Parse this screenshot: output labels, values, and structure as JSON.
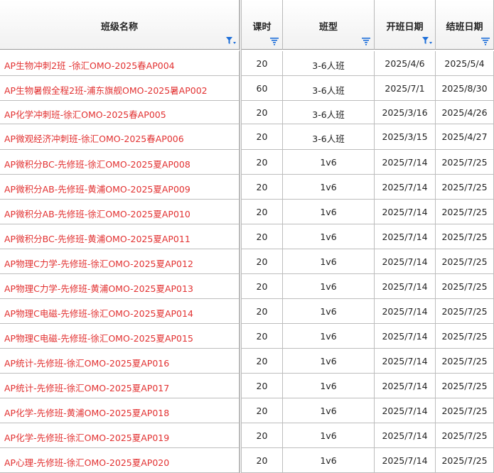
{
  "table": {
    "headers": [
      {
        "key": "name",
        "label": "班级名称",
        "filter": "active"
      },
      {
        "key": "hours",
        "label": "课时",
        "filter": "available"
      },
      {
        "key": "type",
        "label": "班型",
        "filter": "available"
      },
      {
        "key": "start",
        "label": "开班日期",
        "filter": "active"
      },
      {
        "key": "end",
        "label": "结班日期",
        "filter": "available"
      }
    ],
    "rows": [
      {
        "name": "AP生物冲刺2班 -徐汇OMO-2025春AP004",
        "hours": "20",
        "type": "3-6人班",
        "start": "2025/4/6",
        "end": "2025/5/4"
      },
      {
        "name": "AP生物暑假全程2班-浦东旗舰OMO-2025暑AP002",
        "hours": "60",
        "type": "3-6人班",
        "start": "2025/7/1",
        "end": "2025/8/30"
      },
      {
        "name": "AP化学冲刺班-徐汇OMO-2025春AP005",
        "hours": "20",
        "type": "3-6人班",
        "start": "2025/3/16",
        "end": "2025/4/26"
      },
      {
        "name": "AP微观经济冲刺班-徐汇OMO-2025春AP006",
        "hours": "20",
        "type": "3-6人班",
        "start": "2025/3/15",
        "end": "2025/4/27"
      },
      {
        "name": "AP微积分BC-先修班-徐汇OMO-2025夏AP008",
        "hours": "20",
        "type": "1v6",
        "start": "2025/7/14",
        "end": "2025/7/25"
      },
      {
        "name": "AP微积分AB-先修班-黄浦OMO-2025夏AP009",
        "hours": "20",
        "type": "1v6",
        "start": "2025/7/14",
        "end": "2025/7/25"
      },
      {
        "name": "AP微积分AB-先修班-徐汇OMO-2025夏AP010",
        "hours": "20",
        "type": "1v6",
        "start": "2025/7/14",
        "end": "2025/7/25"
      },
      {
        "name": "AP微积分BC-先修班-黄浦OMO-2025夏AP011",
        "hours": "20",
        "type": "1v6",
        "start": "2025/7/14",
        "end": "2025/7/25"
      },
      {
        "name": "AP物理C力学-先修班-徐汇OMO-2025夏AP012",
        "hours": "20",
        "type": "1v6",
        "start": "2025/7/14",
        "end": "2025/7/25"
      },
      {
        "name": "AP物理C力学-先修班-黄浦OMO-2025夏AP013",
        "hours": "20",
        "type": "1v6",
        "start": "2025/7/14",
        "end": "2025/7/25"
      },
      {
        "name": "AP物理C电磁-先修班-徐汇OMO-2025夏AP014",
        "hours": "20",
        "type": "1v6",
        "start": "2025/7/14",
        "end": "2025/7/25"
      },
      {
        "name": "AP物理C电磁-先修班-徐汇OMO-2025夏AP015",
        "hours": "20",
        "type": "1v6",
        "start": "2025/7/14",
        "end": "2025/7/25"
      },
      {
        "name": "AP统计-先修班-徐汇OMO-2025夏AP016",
        "hours": "20",
        "type": "1v6",
        "start": "2025/7/14",
        "end": "2025/7/25"
      },
      {
        "name": "AP统计-先修班-徐汇OMO-2025夏AP017",
        "hours": "20",
        "type": "1v6",
        "start": "2025/7/14",
        "end": "2025/7/25"
      },
      {
        "name": "AP化学-先修班-黄浦OMO-2025夏AP018",
        "hours": "20",
        "type": "1v6",
        "start": "2025/7/14",
        "end": "2025/7/25"
      },
      {
        "name": "AP化学-先修班-徐汇OMO-2025夏AP019",
        "hours": "20",
        "type": "1v6",
        "start": "2025/7/14",
        "end": "2025/7/25"
      },
      {
        "name": "AP心理-先修班-徐汇OMO-2025夏AP020",
        "hours": "20",
        "type": "1v6",
        "start": "2025/7/14",
        "end": "2025/7/25"
      }
    ]
  },
  "colors": {
    "name_text": "#e23131",
    "filter_icon": "#1e6fd9",
    "grid_line": "#bdbdbd"
  }
}
